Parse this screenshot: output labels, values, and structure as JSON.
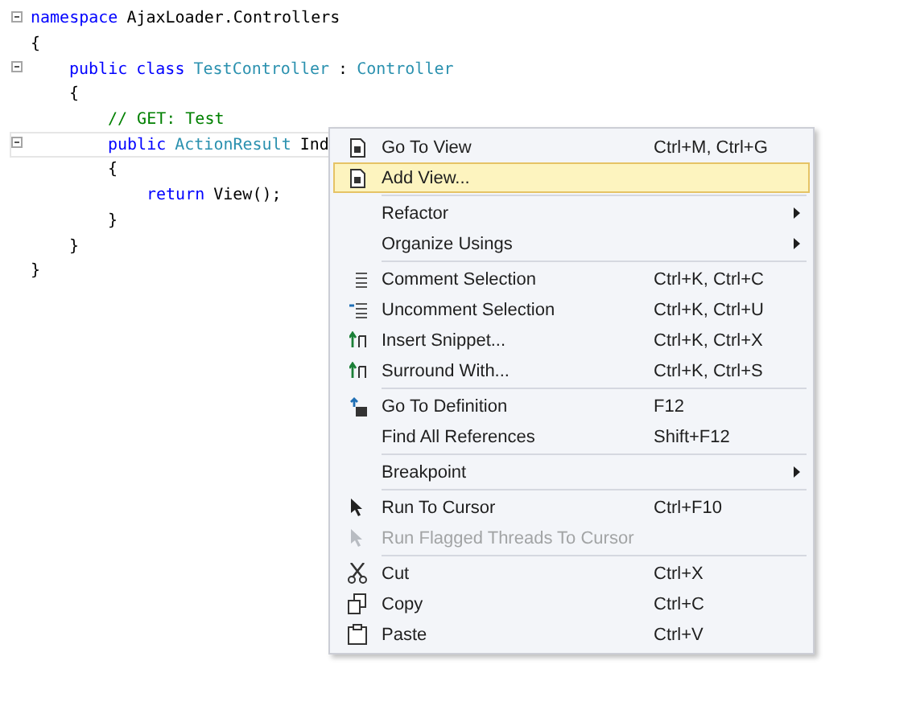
{
  "code": {
    "lines": [
      {
        "collapsible": true,
        "current": false,
        "tokens": [
          {
            "text": "namespace",
            "kind": "keyword"
          },
          {
            "text": "AjaxLoader.Controllers",
            "kind": "plain"
          }
        ]
      },
      {
        "collapsible": false,
        "current": false,
        "tokens": [
          {
            "text": "{",
            "kind": "plain"
          }
        ],
        "children": [
          {
            "collapsible": true,
            "current": false,
            "tokens": [
              {
                "text": "public",
                "kind": "keyword"
              },
              {
                "text": "class",
                "kind": "keyword"
              },
              {
                "text": "TestController",
                "kind": "type"
              },
              {
                "text": ":",
                "kind": "plain"
              },
              {
                "text": "Controller",
                "kind": "type"
              }
            ]
          },
          {
            "collapsible": false,
            "current": false,
            "tokens": [
              {
                "text": "{",
                "kind": "plain"
              }
            ],
            "children": [
              {
                "collapsible": false,
                "current": false,
                "tokens": [
                  {
                    "text": "// GET: Test",
                    "kind": "comment"
                  }
                ]
              },
              {
                "collapsible": true,
                "current": true,
                "tokens": [
                  {
                    "text": "public",
                    "kind": "keyword"
                  },
                  {
                    "text": "ActionResult",
                    "kind": "type"
                  },
                  {
                    "text": "Ind",
                    "kind": "plain"
                  }
                ]
              },
              {
                "collapsible": false,
                "current": false,
                "tokens": [
                  {
                    "text": "{",
                    "kind": "plain"
                  }
                ],
                "children": [
                  {
                    "collapsible": false,
                    "current": false,
                    "tokens": [
                      {
                        "text": "return",
                        "kind": "keyword"
                      },
                      {
                        "text": "View();",
                        "kind": "plain"
                      }
                    ]
                  }
                ]
              },
              {
                "collapsible": false,
                "current": false,
                "tokens": [
                  {
                    "text": "}",
                    "kind": "plain"
                  }
                ]
              }
            ]
          },
          {
            "collapsible": false,
            "current": false,
            "tokens": [
              {
                "text": "}",
                "kind": "plain"
              }
            ]
          }
        ]
      },
      {
        "collapsible": false,
        "current": false,
        "tokens": [
          {
            "text": "}",
            "kind": "plain"
          }
        ]
      }
    ]
  },
  "context_menu": {
    "items": [
      {
        "kind": "item",
        "label": "Go To View",
        "shortcut": "Ctrl+M, Ctrl+G",
        "selected": false,
        "disabled": false,
        "submenu": false
      },
      {
        "kind": "item",
        "label": "Add View...",
        "selected": true,
        "disabled": false,
        "submenu": false
      },
      {
        "kind": "separator"
      },
      {
        "kind": "item",
        "label": "Refactor",
        "selected": false,
        "disabled": false,
        "submenu": true
      },
      {
        "kind": "item",
        "label": "Organize Usings",
        "selected": false,
        "disabled": false,
        "submenu": true
      },
      {
        "kind": "separator"
      },
      {
        "kind": "item",
        "label": "Comment Selection",
        "shortcut": "Ctrl+K, Ctrl+C",
        "selected": false,
        "disabled": false,
        "submenu": false
      },
      {
        "kind": "item",
        "label": "Uncomment Selection",
        "shortcut": "Ctrl+K, Ctrl+U",
        "selected": false,
        "disabled": false,
        "submenu": false
      },
      {
        "kind": "item",
        "label": "Insert Snippet...",
        "shortcut": "Ctrl+K, Ctrl+X",
        "selected": false,
        "disabled": false,
        "submenu": false
      },
      {
        "kind": "item",
        "label": "Surround With...",
        "shortcut": "Ctrl+K, Ctrl+S",
        "selected": false,
        "disabled": false,
        "submenu": false
      },
      {
        "kind": "separator"
      },
      {
        "kind": "item",
        "label": "Go To Definition",
        "shortcut": "F12",
        "selected": false,
        "disabled": false,
        "submenu": false
      },
      {
        "kind": "item",
        "label": "Find All References",
        "shortcut": "Shift+F12",
        "selected": false,
        "disabled": false,
        "submenu": false
      },
      {
        "kind": "separator"
      },
      {
        "kind": "item",
        "label": "Breakpoint",
        "selected": false,
        "disabled": false,
        "submenu": true
      },
      {
        "kind": "separator"
      },
      {
        "kind": "item",
        "label": "Run To Cursor",
        "shortcut": "Ctrl+F10",
        "selected": false,
        "disabled": false,
        "submenu": false
      },
      {
        "kind": "item",
        "label": "Run Flagged Threads To Cursor",
        "selected": false,
        "disabled": true,
        "submenu": false
      },
      {
        "kind": "separator"
      },
      {
        "kind": "item",
        "label": "Cut",
        "shortcut": "Ctrl+X",
        "selected": false,
        "disabled": false,
        "submenu": false
      },
      {
        "kind": "item",
        "label": "Copy",
        "shortcut": "Ctrl+C",
        "selected": false,
        "disabled": false,
        "submenu": false
      },
      {
        "kind": "item",
        "label": "Paste",
        "shortcut": "Ctrl+V",
        "selected": false,
        "disabled": false,
        "submenu": false
      }
    ]
  }
}
